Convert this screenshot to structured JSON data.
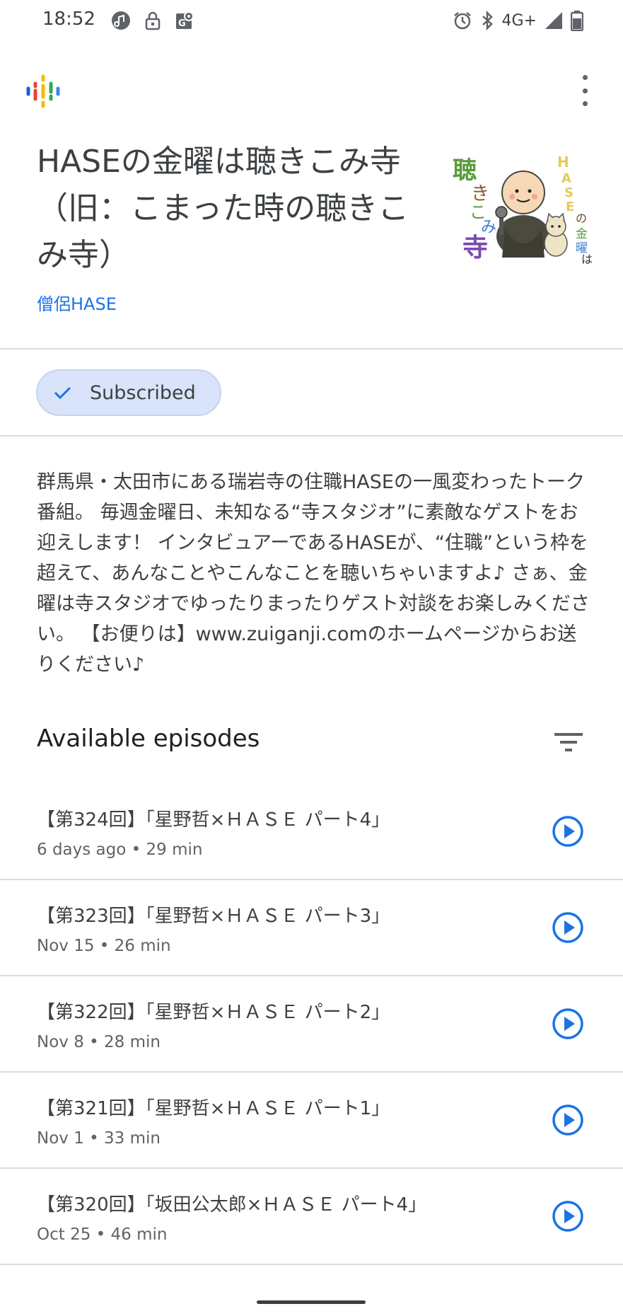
{
  "status_bar": {
    "time": "18:52",
    "network": "4G+"
  },
  "app": {
    "logo_icon": "google-podcasts-logo",
    "menu_icon": "more-vert-icon"
  },
  "podcast": {
    "title": "HASEの金曜は聴きこみ寺（旧：こまった時の聴きこみ寺）",
    "author": "僧侶HASE",
    "cover_text": {
      "vertical_main": "聴きこみ寺",
      "side": "HASEの金曜は"
    },
    "subscribe_label": "Subscribed",
    "description": "群馬県・太田市にある瑞岩寺の住職HASEの一風変わったトーク番組。 毎週金曜日、未知なる“寺スタジオ”に素敵なゲストをお迎えします！ インタビュアーであるHASEが、“住職”という枠を超えて、あんなことやこんなことを聴いちゃいますよ♪ さぁ、金曜は寺スタジオでゆったりまったりゲスト対談をお楽しみください。 【お便りは】www.zuiganji.comのホームページからお送りください♪"
  },
  "episodes_section": {
    "title": "Available episodes",
    "filter_icon": "filter-list-icon"
  },
  "episodes": [
    {
      "title": "【第324回】「星野哲×ＨＡＳＥ パート4」",
      "meta": "6 days ago • 29 min"
    },
    {
      "title": "【第323回】「星野哲×ＨＡＳＥ パート3」",
      "meta": "Nov 15 • 26 min"
    },
    {
      "title": "【第322回】「星野哲×ＨＡＳＥ パート2」",
      "meta": "Nov 8 • 28 min"
    },
    {
      "title": "【第321回】「星野哲×ＨＡＳＥ パート1」",
      "meta": "Nov 1 • 33 min"
    },
    {
      "title": "【第320回】「坂田公太郎×ＨＡＳＥ パート4」",
      "meta": "Oct 25 • 46 min"
    }
  ],
  "colors": {
    "accent": "#1a73e8",
    "subscribed_bg": "#d9e4fa",
    "divider": "#dadce0"
  }
}
